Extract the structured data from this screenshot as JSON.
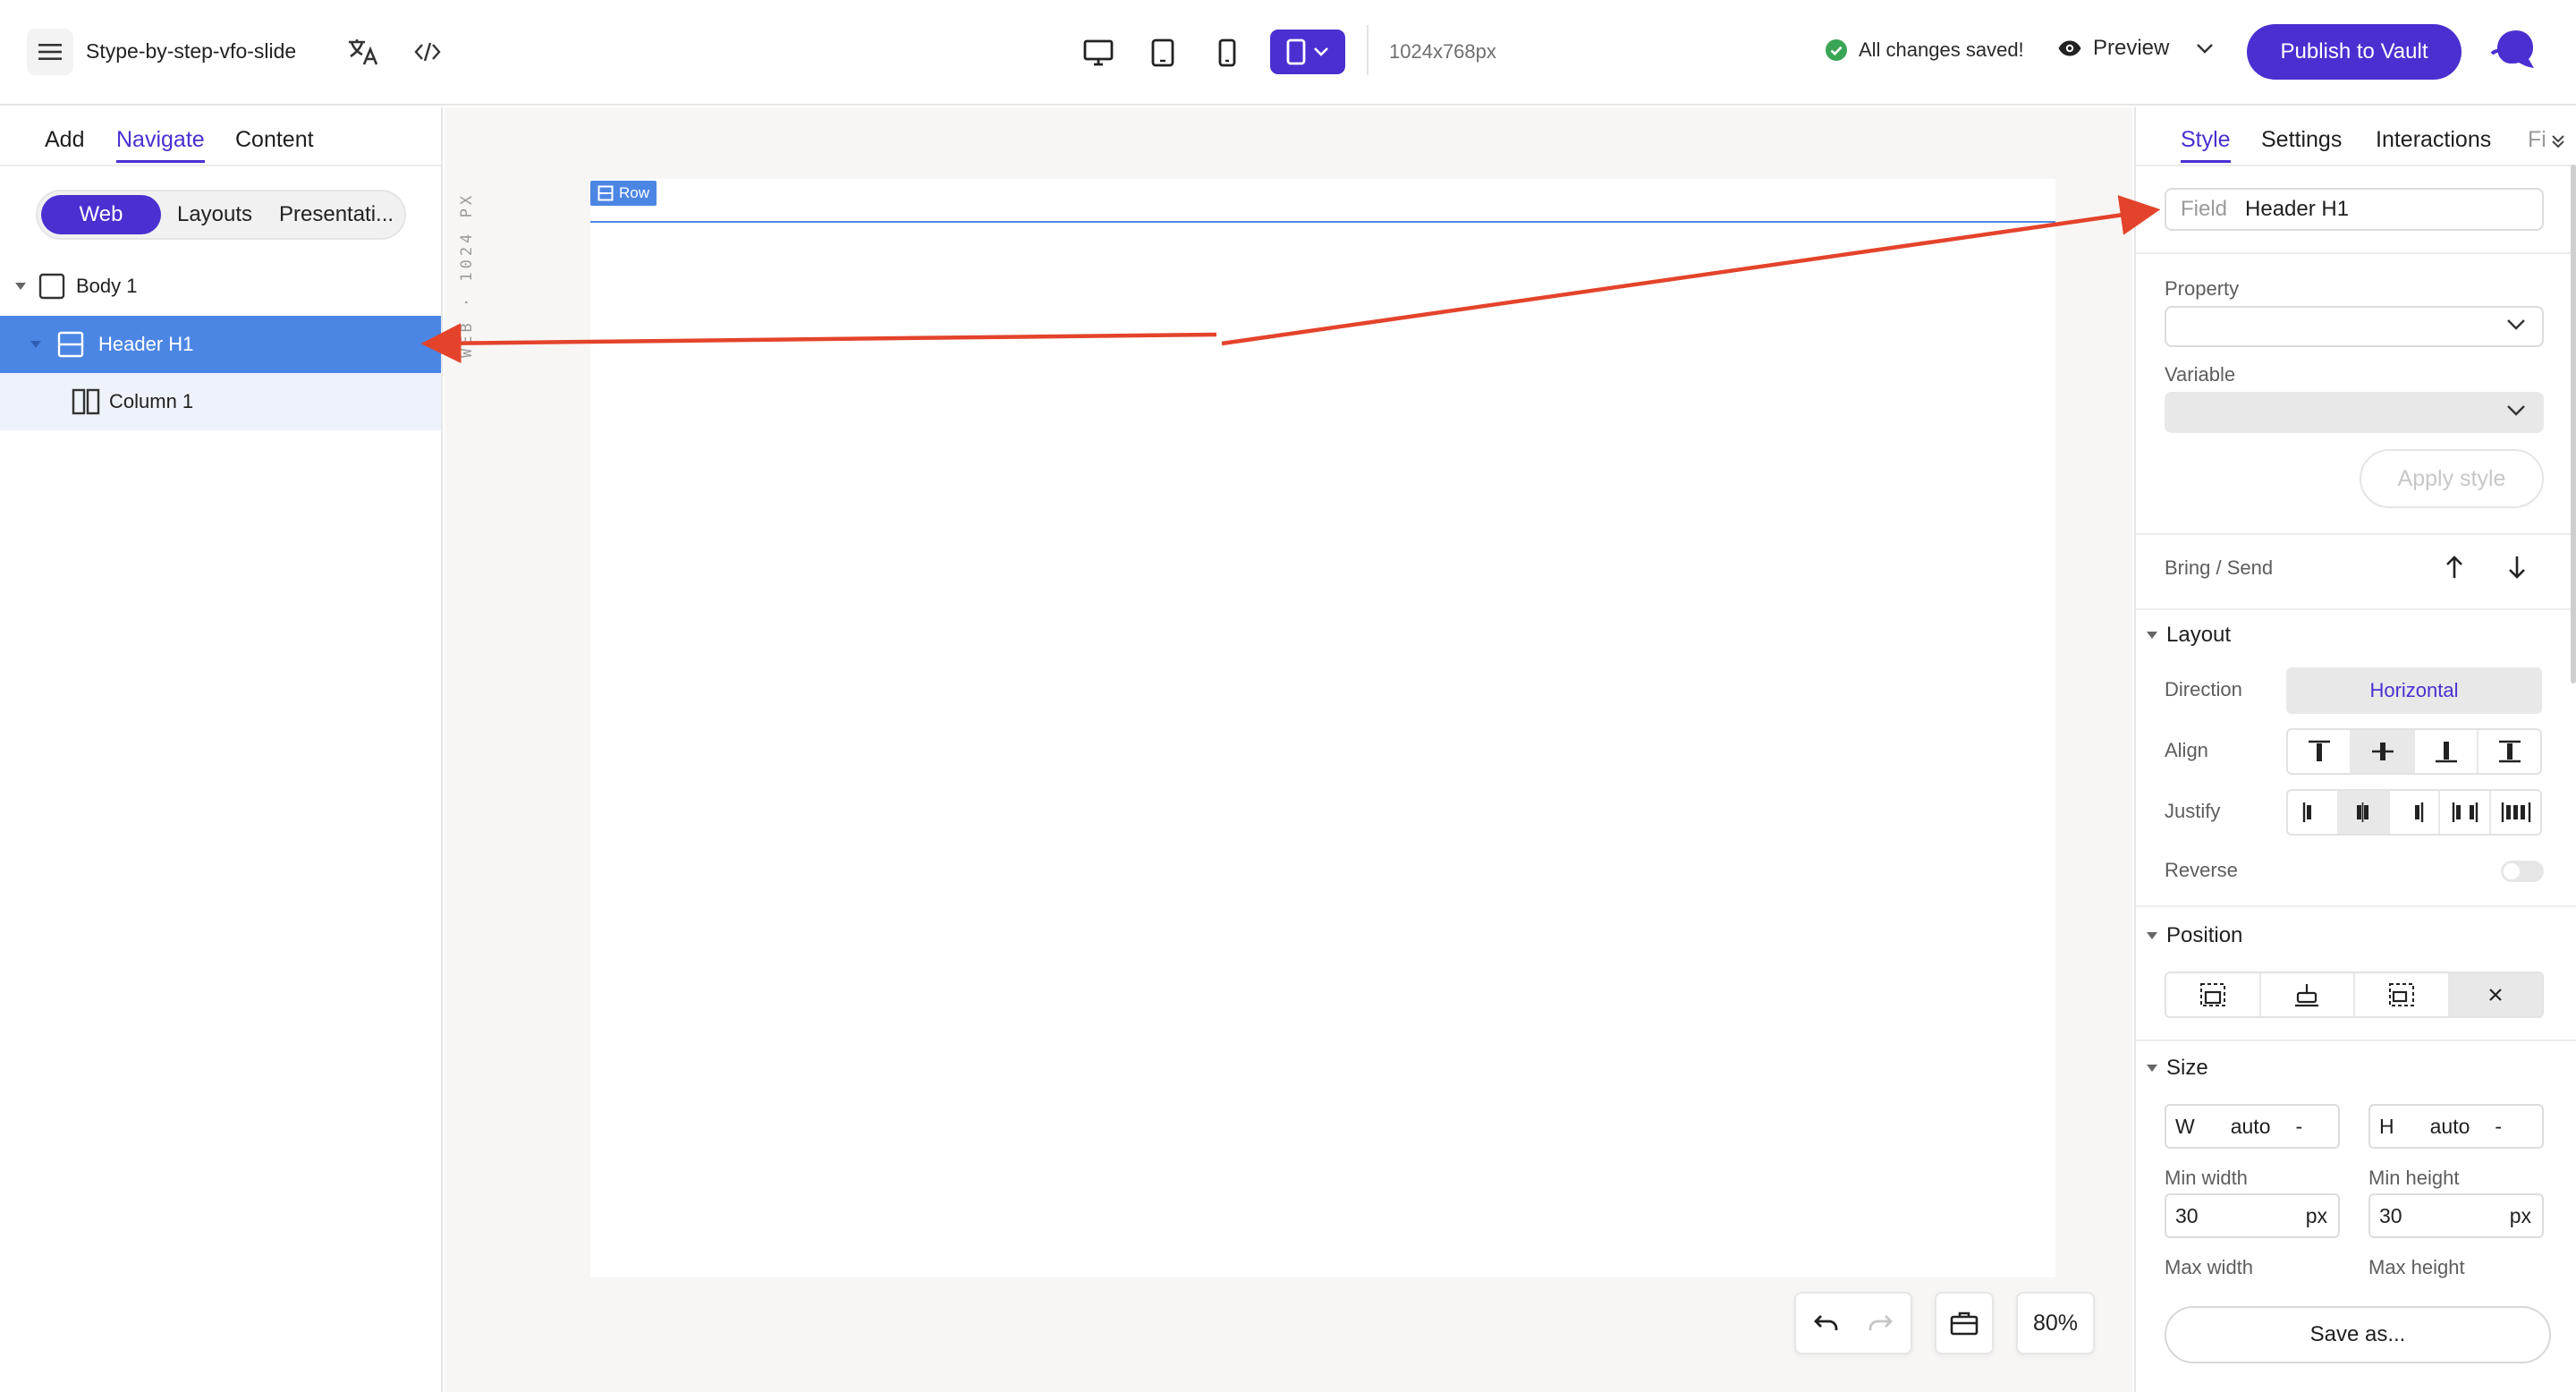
{
  "header": {
    "doc_title": "Stype-by-step-vfo-slide",
    "dimensions": "1024x768px",
    "save_status": "All changes saved!",
    "preview_label": "Preview",
    "publish_label": "Publish to Vault"
  },
  "left_panel": {
    "tabs": [
      "Add",
      "Navigate",
      "Content"
    ],
    "active_tab": "Navigate",
    "segments": [
      "Web",
      "Layouts",
      "Presentati..."
    ],
    "tree": [
      {
        "label": "Body 1",
        "state": "normal"
      },
      {
        "label": "Header H1",
        "state": "selected"
      },
      {
        "label": "Column 1",
        "state": "child"
      }
    ]
  },
  "canvas": {
    "vertical_label": "WEB · 1024 PX",
    "row_tag": "Row",
    "zoom": "80%"
  },
  "right_panel": {
    "tabs": [
      "Style",
      "Settings",
      "Interactions",
      "Fi"
    ],
    "active_tab": "Style",
    "field_label": "Field",
    "field_value": "Header H1",
    "property_label": "Property",
    "variable_label": "Variable",
    "apply_label": "Apply style",
    "bring_send_label": "Bring / Send",
    "layout": {
      "title": "Layout",
      "direction_label": "Direction",
      "direction_value": "Horizontal",
      "align_label": "Align",
      "justify_label": "Justify",
      "reverse_label": "Reverse"
    },
    "position": {
      "title": "Position"
    },
    "size": {
      "title": "Size",
      "w_label": "W",
      "w_value": "auto",
      "h_label": "H",
      "h_value": "auto",
      "dash": "-",
      "min_width_label": "Min width",
      "min_width_value": "30",
      "min_height_label": "Min height",
      "min_height_value": "30",
      "unit": "px",
      "max_width_label": "Max width",
      "max_height_label": "Max height"
    },
    "save_as_label": "Save as..."
  },
  "colors": {
    "accent": "#4b2fd1",
    "selection": "#4c86e4",
    "annotation_arrow": "#e4432b",
    "saved_green": "#3aa655"
  }
}
